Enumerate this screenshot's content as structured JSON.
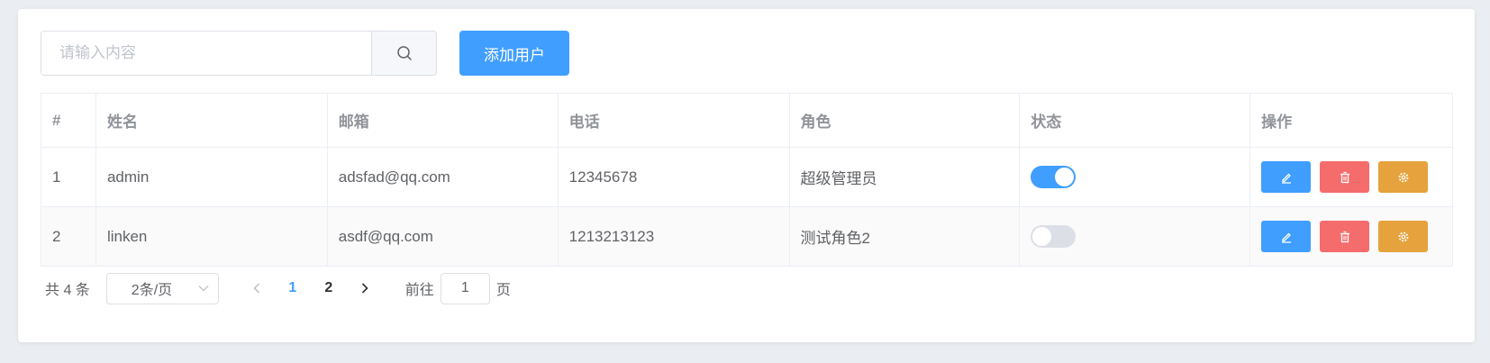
{
  "toolbar": {
    "search_placeholder": "请输入内容",
    "search_icon": "search-icon",
    "add_user_label": "添加用户"
  },
  "table": {
    "headers": [
      "#",
      "姓名",
      "邮箱",
      "电话",
      "角色",
      "状态",
      "操作"
    ],
    "rows": [
      {
        "index": "1",
        "name": "admin",
        "email": "adsfad@qq.com",
        "phone": "12345678",
        "role": "超级管理员",
        "state": true
      },
      {
        "index": "2",
        "name": "linken",
        "email": "asdf@qq.com",
        "phone": "1213213123",
        "role": "测试角色2",
        "state": false
      }
    ],
    "action_icons": [
      "edit-icon",
      "delete-icon",
      "settings-icon"
    ]
  },
  "pagination": {
    "total_text": "共 4 条",
    "page_size_label": "2条/页",
    "pages": [
      "1",
      "2"
    ],
    "current_page": "1",
    "goto_prefix": "前往",
    "goto_value": "1",
    "goto_suffix": "页"
  },
  "colors": {
    "primary": "#409eff",
    "danger": "#f56c6c",
    "warning": "#e6a23c",
    "switch_off": "#dcdfe6"
  }
}
